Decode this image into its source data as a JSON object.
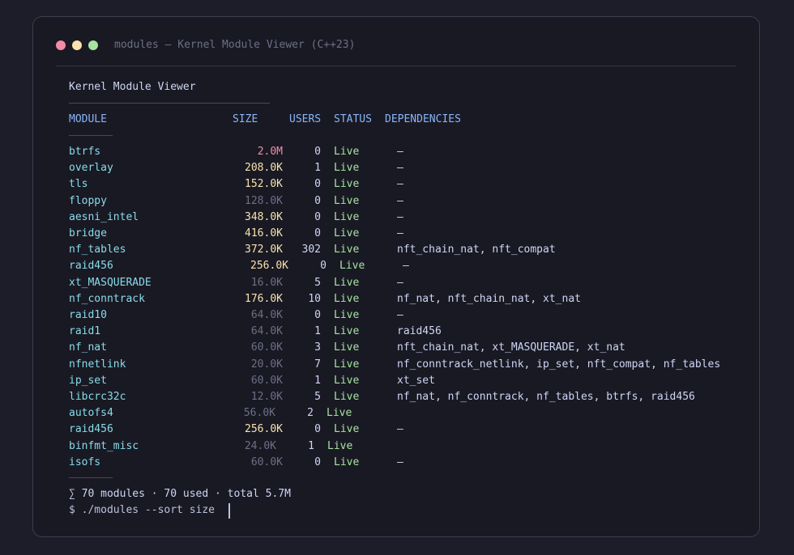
{
  "window": {
    "title": "modules — Kernel Module Viewer (C++23)"
  },
  "app": {
    "title": "Kernel Module Viewer"
  },
  "table": {
    "headers": {
      "module": "MODULE",
      "size": "SIZE",
      "users": "USERS",
      "status": "STATUS",
      "dependencies": "DEPENDENCIES"
    },
    "rows": [
      {
        "name": "btrfs",
        "size": "2.0M",
        "users": "0",
        "status": "Live",
        "deps": "–",
        "size_color": "#f38ba8"
      },
      {
        "name": "overlay",
        "size": "208.0K",
        "users": "1",
        "status": "Live",
        "deps": "–",
        "size_color": "#f9e2af"
      },
      {
        "name": "tls",
        "size": "152.0K",
        "users": "0",
        "status": "Live",
        "deps": "–",
        "size_color": "#f9e2af"
      },
      {
        "name": "floppy",
        "size": "128.0K",
        "users": "0",
        "status": "Live",
        "deps": "–",
        "size_color": "#6c7086"
      },
      {
        "name": "aesni_intel",
        "size": "348.0K",
        "users": "0",
        "status": "Live",
        "deps": "–",
        "size_color": "#f9e2af"
      },
      {
        "name": "bridge",
        "size": "416.0K",
        "users": "0",
        "status": "Live",
        "deps": "–",
        "size_color": "#f9e2af"
      },
      {
        "name": "nf_tables",
        "size": "372.0K",
        "users": "302",
        "status": "Live",
        "deps": "nft_chain_nat, nft_compat",
        "size_color": "#f9e2af"
      },
      {
        "name": "raid456",
        "size": "256.0K",
        "users": "0",
        "status": "Live",
        "deps": "–",
        "size_color": "#f9e2af"
      },
      {
        "name": "xt_MASQUERADE",
        "size": "16.0K",
        "users": "5",
        "status": "Live",
        "deps": "–",
        "size_color": "#6c7086"
      },
      {
        "name": "nf_conntrack",
        "size": "176.0K",
        "users": "10",
        "status": "Live",
        "deps": "nf_nat, nft_chain_nat, xt_nat",
        "size_color": "#f9e2af"
      },
      {
        "name": "raid10",
        "size": "64.0K",
        "users": "0",
        "status": "Live",
        "deps": "–",
        "size_color": "#6c7086"
      },
      {
        "name": "raid1",
        "size": "64.0K",
        "users": "1",
        "status": "Live",
        "deps": "raid456",
        "size_color": "#6c7086"
      },
      {
        "name": "nf_nat",
        "size": "60.0K",
        "users": "3",
        "status": "Live",
        "deps": "nft_chain_nat, xt_MASQUERADE, xt_nat",
        "size_color": "#6c7086"
      },
      {
        "name": "nfnetlink",
        "size": "20.0K",
        "users": "7",
        "status": "Live",
        "deps": "nf_conntrack_netlink, ip_set, nft_compat, nf_tables",
        "size_color": "#6c7086"
      },
      {
        "name": "ip_set",
        "size": "60.0K",
        "users": "1",
        "status": "Live",
        "deps": "xt_set",
        "size_color": "#6c7086"
      },
      {
        "name": "libcrc32c",
        "size": "12.0K",
        "users": "5",
        "status": "Live",
        "deps": "nf_nat, nf_conntrack, nf_tables, btrfs, raid456",
        "size_color": "#6c7086"
      },
      {
        "name": "autofs4",
        "size": "56.0K",
        "users": "2",
        "status": "Live",
        "deps": "",
        "size_color": "#6c7086"
      },
      {
        "name": "raid456",
        "size": "256.0K",
        "users": "0",
        "status": "Live",
        "deps": "–",
        "size_color": "#f9e2af"
      },
      {
        "name": "binfmt_misc",
        "size": "24.0K",
        "users": "1",
        "status": "Live",
        "deps": "",
        "size_color": "#6c7086"
      },
      {
        "name": "isofs",
        "size": "60.0K",
        "users": "0",
        "status": "Live",
        "deps": "–",
        "size_color": "#6c7086"
      }
    ]
  },
  "footer": {
    "summary": "∑ 70 modules · 70 used · total 5.7M",
    "prompt": "$ ./modules --sort size"
  },
  "colors": {
    "background": "#1d1d29",
    "window": "#191923",
    "module_name": "#89dceb",
    "header": "#89b4fa",
    "status_live": "#a6e3a1"
  }
}
